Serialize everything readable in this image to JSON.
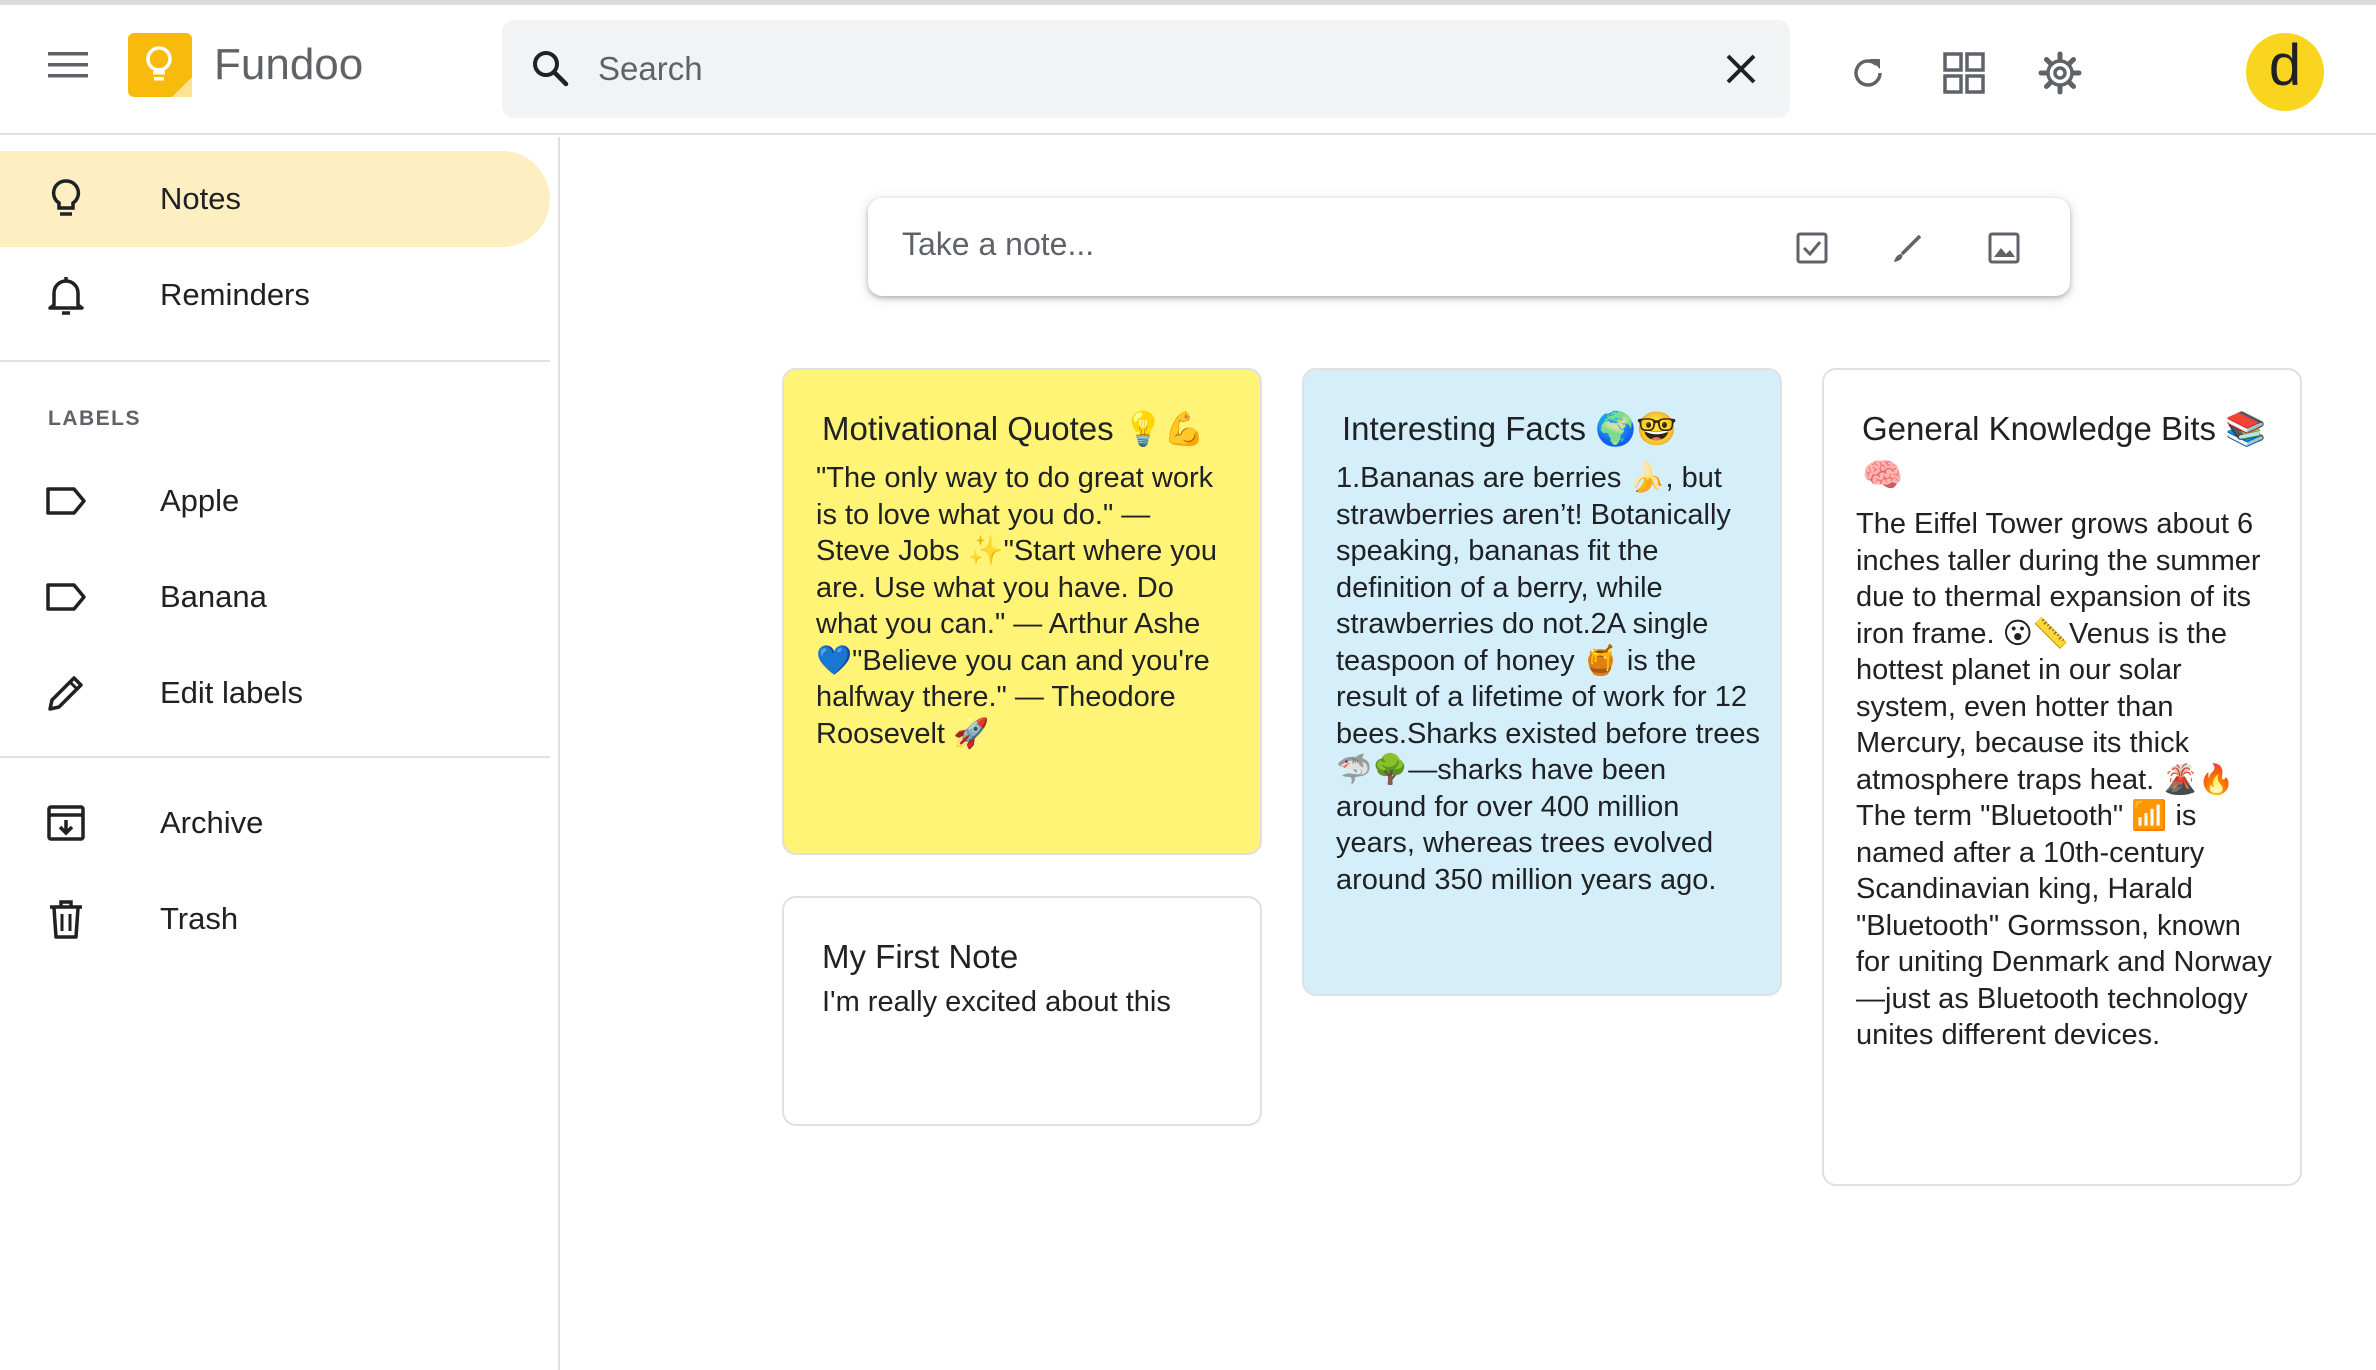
{
  "header": {
    "app_title": "Fundoo",
    "search_placeholder": "Search",
    "avatar_letter": "d",
    "logo_color": "#f9bb0b"
  },
  "sidebar": {
    "items": [
      {
        "label": "Notes",
        "icon": "lightbulb-icon",
        "active": true
      },
      {
        "label": "Reminders",
        "icon": "bell-icon"
      }
    ],
    "labels_heading": "LABELS",
    "labels": [
      {
        "label": "Apple",
        "icon": "label-icon"
      },
      {
        "label": "Banana",
        "icon": "label-icon"
      },
      {
        "label": "Edit labels",
        "icon": "pencil-icon"
      }
    ],
    "bottom": [
      {
        "label": "Archive",
        "icon": "archive-icon"
      },
      {
        "label": "Trash",
        "icon": "trash-icon"
      }
    ],
    "active_color": "#feefc3"
  },
  "main": {
    "take_note_placeholder": "Take a note...",
    "notes": [
      {
        "title": "Motivational Quotes 💡💪",
        "body": " \"The only way to do great work is to love what you do.\" — Steve Jobs ✨\"Start where you are. Use what you have. Do what you can.\" — Arthur Ashe 💙\"Believe you can and you're halfway there.\" — Theodore Roosevelt 🚀",
        "color": "#fff475"
      },
      {
        "title": "My First Note",
        "body": "I'm really excited about this",
        "color": "#ffffff"
      },
      {
        "title": "Interesting Facts 🌍🤓",
        "body": " 1.Bananas are berries 🍌, but strawberries aren’t! Botanically speaking, bananas fit the definition of a berry, while strawberries do not.2A single teaspoon of honey 🍯 is the result of a lifetime of work for 12 bees.Sharks existed before trees 🦈🌳—sharks have been around for over 400 million years, whereas trees evolved around 350 million years ago.",
        "color": "#d4effa"
      },
      {
        "title": "General Knowledge Bits 📚🧠",
        "body": " The Eiffel Tower grows about 6 inches taller during the summer due to thermal expansion of its iron frame. 😮📏Venus is the hottest planet in our solar system, even hotter than Mercury, because its thick atmosphere traps heat. 🌋🔥The term \"Bluetooth\" 📶 is named after a 10th-century Scandinavian king, Harald \"Bluetooth\" Gormsson, known for uniting Denmark and Norway—just as Bluetooth technology unites different devices.",
        "color": "#ffffff"
      }
    ]
  }
}
